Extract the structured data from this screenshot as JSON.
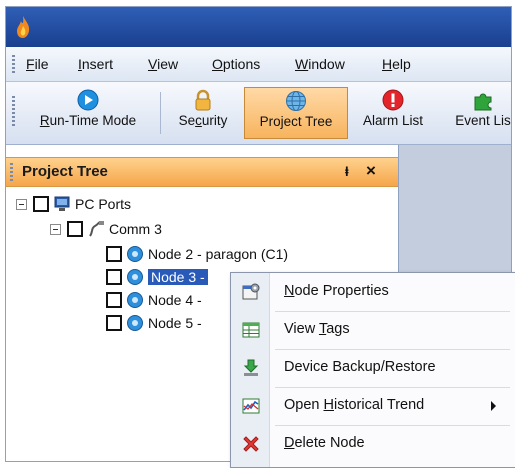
{
  "menubar": {
    "items": [
      {
        "prefix": "",
        "key": "F",
        "rest": "ile"
      },
      {
        "prefix": "",
        "key": "I",
        "rest": "nsert"
      },
      {
        "prefix": "",
        "key": "V",
        "rest": "iew"
      },
      {
        "prefix": "",
        "key": "O",
        "rest": "ptions"
      },
      {
        "prefix": "",
        "key": "W",
        "rest": "indow"
      },
      {
        "prefix": "",
        "key": "H",
        "rest": "elp"
      }
    ]
  },
  "toolbar": {
    "items": [
      {
        "prefix": "",
        "key": "R",
        "rest": "un-Time Mode",
        "icon": "play-icon"
      },
      {
        "prefix": "Se",
        "key": "c",
        "rest": "urity",
        "icon": "lock-icon"
      },
      {
        "prefix": "",
        "key": "",
        "rest": "Project Tree",
        "icon": "globe-icon",
        "active": true
      },
      {
        "prefix": "",
        "key": "",
        "rest": "Alarm List",
        "icon": "alarm-icon"
      },
      {
        "prefix": "",
        "key": "",
        "rest": "Event Lis",
        "icon": "puzzle-icon"
      }
    ]
  },
  "panel": {
    "title": "Project Tree",
    "pin_glyph": "ⱡ",
    "close_glyph": "×"
  },
  "tree": {
    "root": "PC Ports",
    "channel": "Comm 3",
    "nodes": [
      "Node 2 - paragon (C1)",
      "Node 3 - ",
      "Node 4 - ",
      "Node 5 - "
    ]
  },
  "context_menu": {
    "items": [
      {
        "prefix": "",
        "key": "N",
        "rest": "ode Properties",
        "icon": "properties-icon"
      },
      {
        "prefix": "View ",
        "key": "T",
        "rest": "ags",
        "icon": "table-icon"
      },
      {
        "prefix": "",
        "key": "",
        "rest": "Device Backup/Restore",
        "icon": "backup-icon"
      },
      {
        "prefix": "Open ",
        "key": "H",
        "rest": "istorical Trend",
        "icon": "trend-icon",
        "submenu": true
      },
      {
        "prefix": "",
        "key": "D",
        "rest": "elete Node",
        "icon": "delete-icon"
      }
    ]
  },
  "colors": {
    "titlebar": "#2f5fb6",
    "panel_header": "#f5a64a",
    "selection": "#2a5ab8",
    "active_tool": "#f7b45e"
  }
}
